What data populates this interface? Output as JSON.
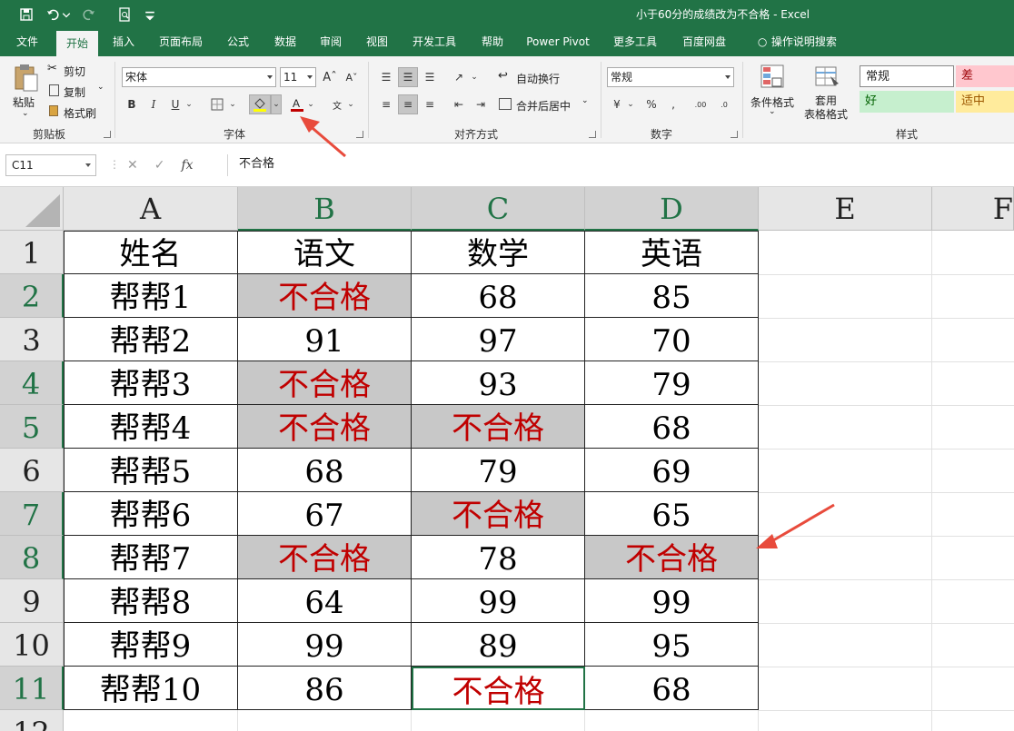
{
  "window": {
    "title": "小于60分的成绩改为不合格 - Excel"
  },
  "ribbon_tabs": [
    "文件",
    "开始",
    "插入",
    "页面布局",
    "公式",
    "数据",
    "审阅",
    "视图",
    "开发工具",
    "帮助",
    "Power Pivot",
    "更多工具",
    "百度网盘",
    "操作说明搜索"
  ],
  "active_tab": "开始",
  "clipboard": {
    "paste": "粘贴",
    "cut": "剪切",
    "copy": "复制",
    "format_painter": "格式刷",
    "group": "剪贴板"
  },
  "font": {
    "name": "宋体",
    "size": "11",
    "bold": "B",
    "italic": "I",
    "underline": "U",
    "group": "字体",
    "fill_color": "#ffff00",
    "font_color": "#c00000"
  },
  "alignment": {
    "wrap": "自动换行",
    "merge": "合并后居中",
    "group": "对齐方式"
  },
  "number": {
    "format": "常规",
    "group": "数字"
  },
  "styles": {
    "conditional": "条件格式",
    "table_format": "套用\n表格格式",
    "cells": [
      {
        "label": "常规",
        "bg": "#ffffff",
        "color": "#000000"
      },
      {
        "label": "差",
        "bg": "#ffc7ce",
        "color": "#9c0006"
      },
      {
        "label": "好",
        "bg": "#c6efce",
        "color": "#006100"
      },
      {
        "label": "适中",
        "bg": "#ffeb9c",
        "color": "#9c5700"
      }
    ],
    "group": "样式"
  },
  "formula_bar": {
    "name_box": "C11",
    "fx": "fx",
    "content": "不合格"
  },
  "columns": [
    "A",
    "B",
    "C",
    "D",
    "E",
    "F"
  ],
  "rows": [
    "1",
    "2",
    "3",
    "4",
    "5",
    "6",
    "7",
    "8",
    "9",
    "10",
    "11",
    "12"
  ],
  "table": [
    [
      "姓名",
      "语文",
      "数学",
      "英语"
    ],
    [
      "帮帮1",
      "不合格",
      "68",
      "85"
    ],
    [
      "帮帮2",
      "91",
      "97",
      "70"
    ],
    [
      "帮帮3",
      "不合格",
      "93",
      "79"
    ],
    [
      "帮帮4",
      "不合格",
      "不合格",
      "68"
    ],
    [
      "帮帮5",
      "68",
      "79",
      "69"
    ],
    [
      "帮帮6",
      "67",
      "不合格",
      "65"
    ],
    [
      "帮帮7",
      "不合格",
      "78",
      "不合格"
    ],
    [
      "帮帮8",
      "64",
      "99",
      "99"
    ],
    [
      "帮帮9",
      "99",
      "89",
      "95"
    ],
    [
      "帮帮10",
      "86",
      "不合格",
      "68"
    ]
  ],
  "colors": {
    "excel_green": "#217346",
    "fail_text": "#c00000",
    "fail_fill": "#c8c8c8",
    "annotation": "#e84b3c"
  }
}
